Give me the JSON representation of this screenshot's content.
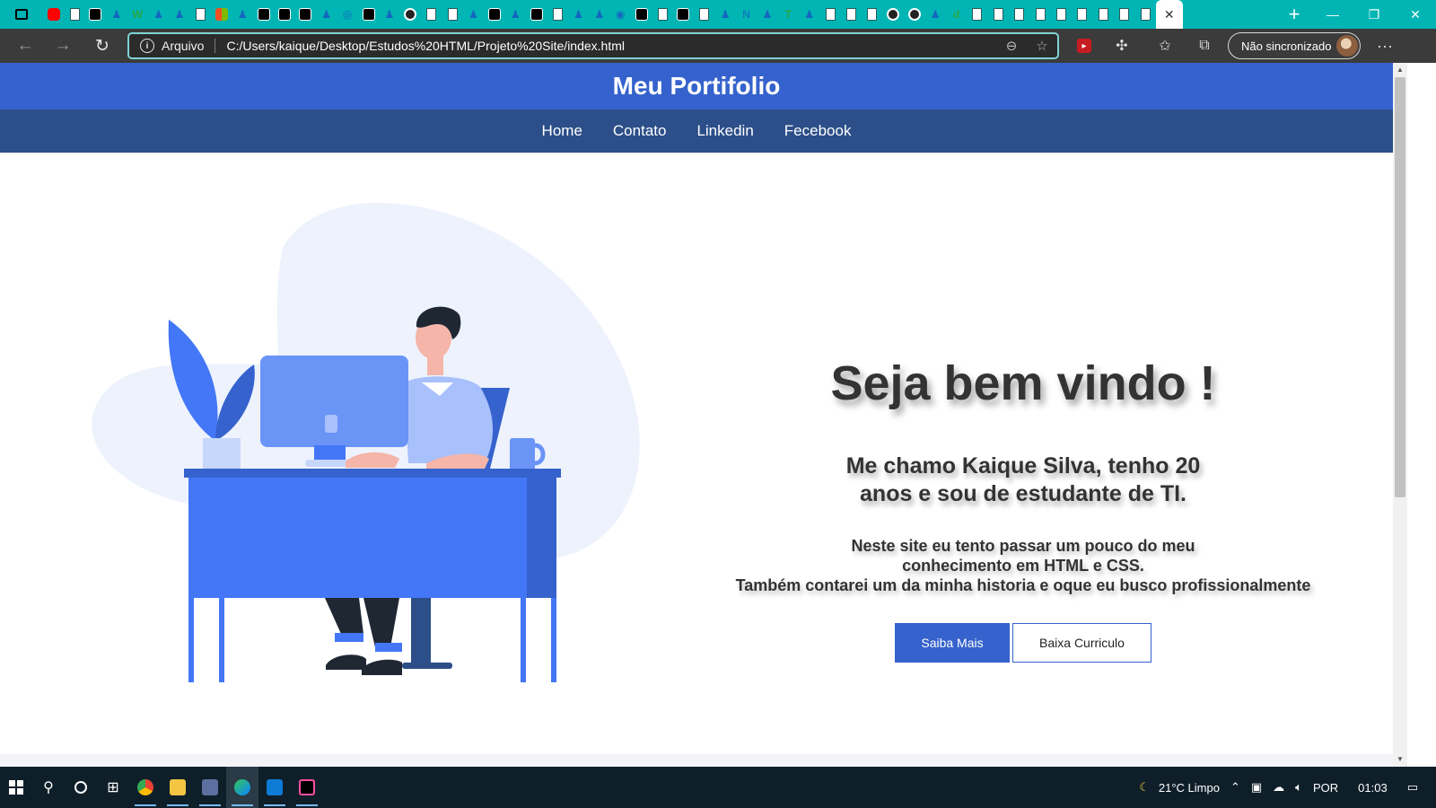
{
  "browser": {
    "active_tab_close": "✕",
    "new_tab": "+",
    "window_controls": [
      "—",
      "❐",
      "✕"
    ],
    "address": {
      "scheme_label": "Arquivo",
      "url": "C:/Users/kaique/Desktop/Estudos%20HTML/Projeto%20Site/index.html"
    },
    "profile_label": "Não sincronizado",
    "more_label": "···"
  },
  "site": {
    "title": "Meu Portifolio",
    "nav": [
      "Home",
      "Contato",
      "Linkedin",
      "Fecebook"
    ],
    "hero": {
      "heading": "Seja bem vindo !",
      "subheading": "Me chamo Kaique Silva, tenho 20 anos e sou de estudante de TI.",
      "paragraph_lines": [
        "Neste site eu tento passar um pouco do meu",
        "conhecimento em HTML e CSS.",
        "Também contarei um da minha historia e oque eu busco profissionalmente"
      ],
      "primary_button": "Saiba Mais",
      "secondary_button": "Baixa Curriculo"
    }
  },
  "taskbar": {
    "weather": "21°C  Limpo",
    "language": "POR",
    "time": "01:03"
  },
  "colors": {
    "tab_strip": "#00b5b3",
    "header": "#3562cc",
    "nav": "#2c4f89",
    "illustration_blue": "#4377f7",
    "blob": "#edf2fd"
  }
}
